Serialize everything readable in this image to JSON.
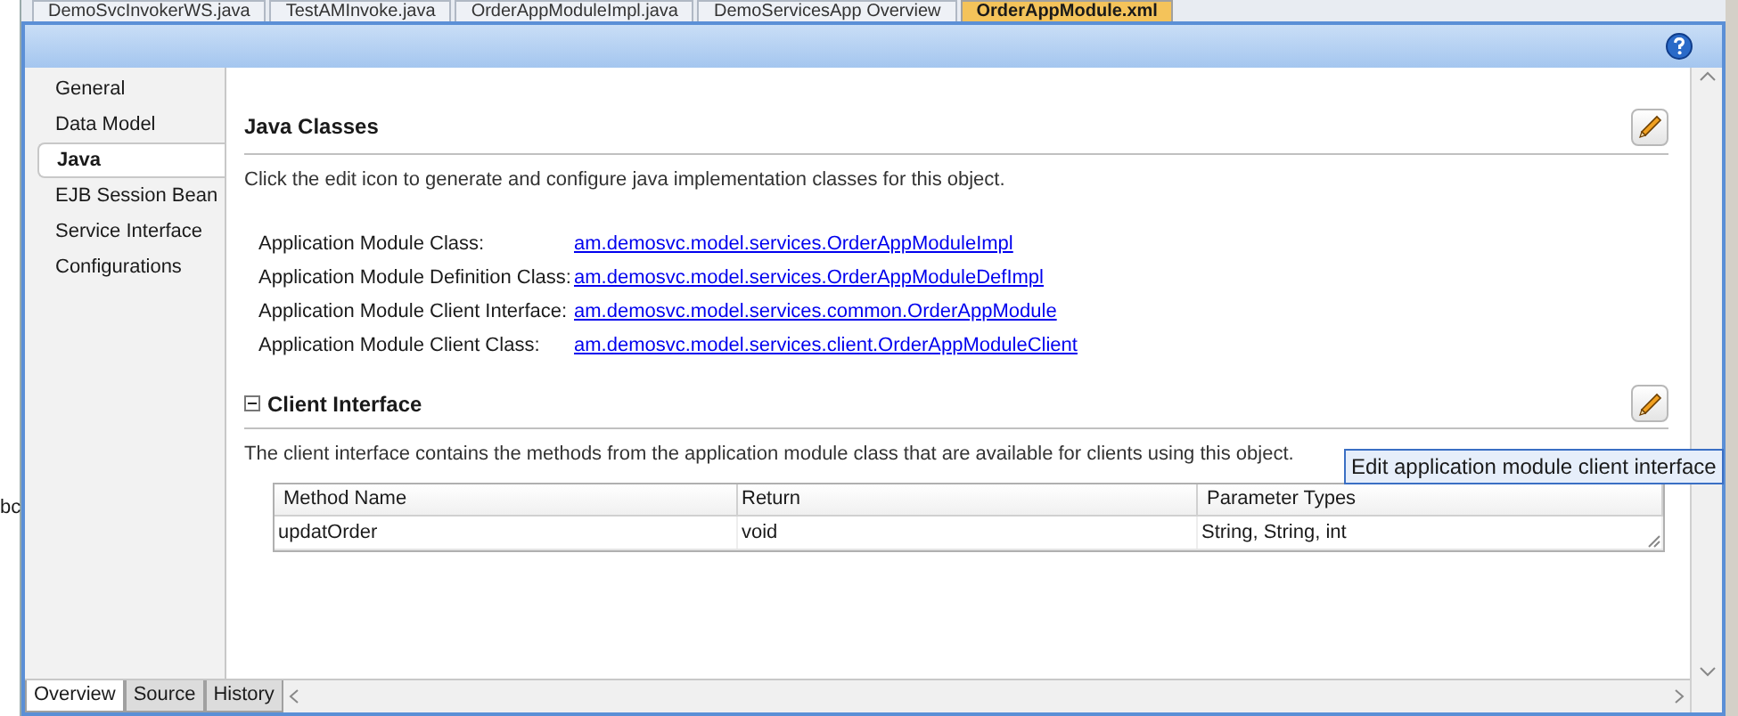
{
  "editor_tabs": [
    {
      "label": "DemoSvcInvokerWS.java",
      "selected": false
    },
    {
      "label": "TestAMInvoke.java",
      "selected": false
    },
    {
      "label": "OrderAppModuleImpl.java",
      "selected": false
    },
    {
      "label": "DemoServicesApp Overview",
      "selected": false
    },
    {
      "label": "OrderAppModule.xml",
      "selected": true
    }
  ],
  "left_fragment": "bc",
  "nav": [
    {
      "label": "General",
      "selected": false
    },
    {
      "label": "Data Model",
      "selected": false
    },
    {
      "label": "Java",
      "selected": true
    },
    {
      "label": "EJB Session Bean",
      "selected": false
    },
    {
      "label": "Service Interface",
      "selected": false
    },
    {
      "label": "Configurations",
      "selected": false
    }
  ],
  "java_classes": {
    "title": "Java Classes",
    "description": "Click the edit icon to generate and configure java implementation classes for this object.",
    "rows": [
      {
        "label": "Application Module Class:",
        "value": "am.demosvc.model.services.OrderAppModuleImpl"
      },
      {
        "label": "Application Module Definition Class:",
        "value": "am.demosvc.model.services.OrderAppModuleDefImpl"
      },
      {
        "label": "Application Module Client Interface:",
        "value": "am.demosvc.model.services.common.OrderAppModule"
      },
      {
        "label": "Application Module Client Class:",
        "value": "am.demosvc.model.services.client.OrderAppModuleClient"
      }
    ]
  },
  "client_interface": {
    "title": "Client Interface",
    "expanded": true,
    "description": "The client interface contains the methods from the application module class that are available for clients using this object.",
    "table": {
      "columns": [
        "Method Name",
        "Return",
        "Parameter Types"
      ],
      "rows": [
        [
          "updatOrder",
          "void",
          "String, String, int"
        ]
      ]
    }
  },
  "tooltip": "Edit application module client interface",
  "bottom_tabs": [
    {
      "label": "Overview",
      "selected": true
    },
    {
      "label": "Source",
      "selected": false
    },
    {
      "label": "History",
      "selected": false
    }
  ]
}
